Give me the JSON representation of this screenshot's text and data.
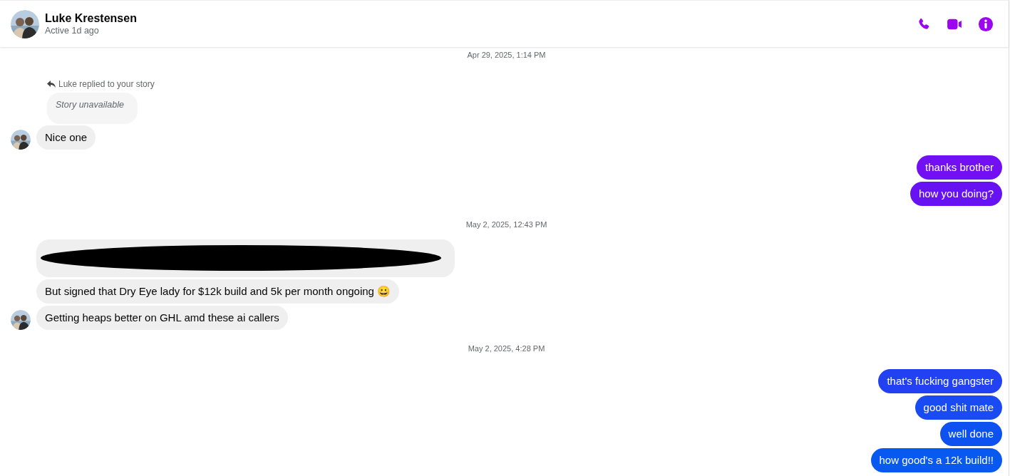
{
  "header": {
    "name": "Luke Krestensen",
    "status": "Active 1d ago"
  },
  "thread": [
    {
      "kind": "timestamp",
      "text": "Apr 29, 2025, 1:14 PM"
    },
    {
      "kind": "story_reply",
      "label": "Luke replied to your story",
      "story": "Story unavailable"
    },
    {
      "kind": "incoming",
      "messages": [
        {
          "kind": "text",
          "text": "Nice one"
        }
      ]
    },
    {
      "kind": "outgoing",
      "messages": [
        {
          "text": "thanks brother",
          "color": "#7310f3"
        },
        {
          "text": "how you doing?",
          "color": "#6612f2"
        }
      ]
    },
    {
      "kind": "timestamp",
      "text": "May 2, 2025, 12:43 PM"
    },
    {
      "kind": "incoming",
      "messages": [
        {
          "kind": "redacted"
        },
        {
          "kind": "text",
          "text": "But signed that Dry Eye lady for $12k build and 5k per month ongoing 😀"
        },
        {
          "kind": "text",
          "text": "Getting heaps better on GHL amd these ai callers"
        }
      ]
    },
    {
      "kind": "timestamp",
      "text": "May 2, 2025, 4:28 PM"
    },
    {
      "kind": "outgoing",
      "messages": [
        {
          "text": "that's fucking gangster",
          "color": "#2141f3"
        },
        {
          "text": "good shit mate",
          "color": "#1a4af2"
        },
        {
          "text": "well done",
          "color": "#0d52f0"
        },
        {
          "text": "how good's a 12k build!!",
          "color": "#0759ef"
        }
      ]
    }
  ]
}
